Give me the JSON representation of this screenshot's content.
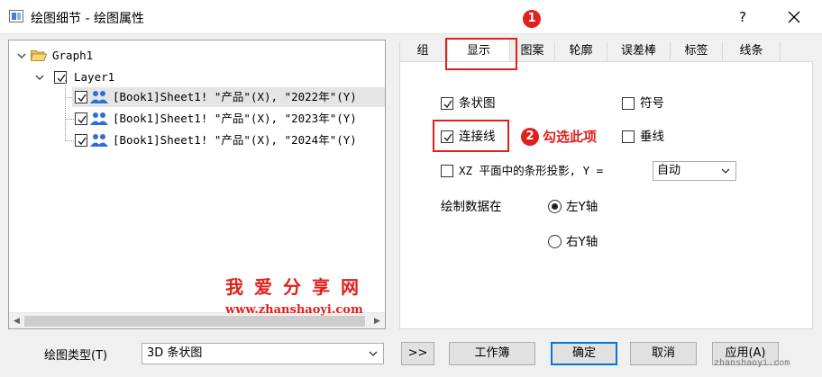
{
  "window": {
    "title": "绘图细节 - 绘图属性",
    "help_label": "?"
  },
  "tree": {
    "root_label": "Graph1",
    "layer_label": "Layer1",
    "plots": [
      "[Book1]Sheet1! \"产品\"(X), \"2022年\"(Y)",
      "[Book1]Sheet1! \"产品\"(X), \"2023年\"(Y)",
      "[Book1]Sheet1! \"产品\"(X), \"2024年\"(Y)"
    ]
  },
  "watermark": {
    "name": "我爱分享网",
    "url": "www.zhanshaoyi.com"
  },
  "tabs": [
    "组",
    "显示",
    "图案",
    "轮廓",
    "误差棒",
    "标签",
    "线条"
  ],
  "active_tab": "显示",
  "display": {
    "bar_label": "条状图",
    "bar_checked": true,
    "symbol_label": "符号",
    "symbol_checked": false,
    "connect_label": "连接线",
    "connect_checked": true,
    "drop_label": "垂线",
    "drop_checked": false,
    "xz_label": "XZ 平面中的条形投影, Y =",
    "xz_checked": false,
    "xz_value": "自动",
    "plot_on_label": "绘制数据在",
    "left_axis_label": "左Y轴",
    "right_axis_label": "右Y轴",
    "selected_axis": "左Y轴"
  },
  "annotations": {
    "badge1": "1",
    "badge2": "2",
    "hint": "勾选此项"
  },
  "bottom": {
    "plot_type_label": "绘图类型(T)",
    "plot_type_value": "3D 条状图",
    "more_label": ">>",
    "workbook_label": "工作簿",
    "ok_label": "确定",
    "cancel_label": "取消",
    "apply_label": "应用(A)"
  },
  "site_tag": "zhanshaoyi.com",
  "colors": {
    "accent_red": "#e0201c",
    "default_button_border": "#0078d7",
    "people_icon": "#2f6fd6"
  }
}
